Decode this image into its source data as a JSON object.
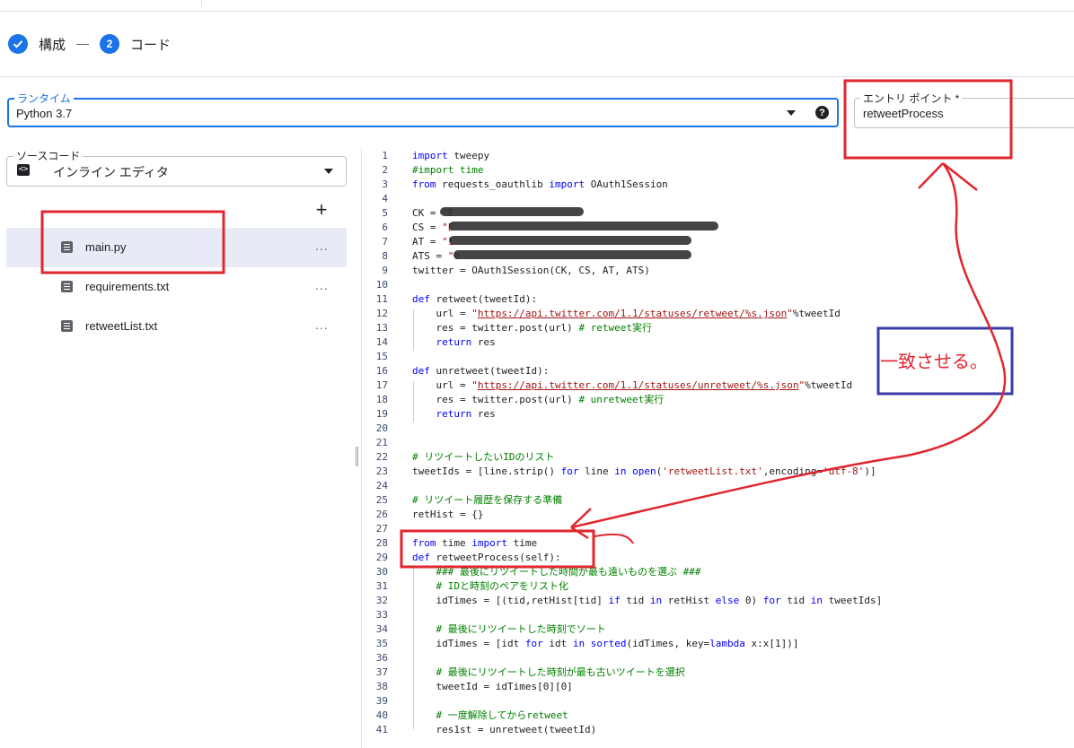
{
  "stepper": {
    "step1_label": "構成",
    "step2_number": "2",
    "step2_label": "コード"
  },
  "runtime": {
    "label": "ランタイム",
    "value": "Python 3.7",
    "help": "?"
  },
  "entry_point": {
    "label": "エントリ ポイント *",
    "value": "retweetProcess"
  },
  "source": {
    "label": "ソースコード",
    "value": "インライン エディタ"
  },
  "files": {
    "add": "+",
    "items": [
      {
        "name": "main.py",
        "more": "..."
      },
      {
        "name": "requirements.txt",
        "more": "..."
      },
      {
        "name": "retweetList.txt",
        "more": "..."
      }
    ]
  },
  "annotation": {
    "text": "一致させる。"
  },
  "code": {
    "lines": [
      {
        "n": "1",
        "t": "import tweepy"
      },
      {
        "n": "2",
        "t": "#import time"
      },
      {
        "n": "3",
        "t": "from requests_oauthlib import OAuth1Session"
      },
      {
        "n": "4",
        "t": ""
      },
      {
        "n": "5",
        "t": "CK = \"E"
      },
      {
        "n": "6",
        "t": "CS = \"E"
      },
      {
        "n": "7",
        "t": "AT = \"1"
      },
      {
        "n": "8",
        "t": "ATS = \"e"
      },
      {
        "n": "9",
        "t": "twitter = OAuth1Session(CK, CS, AT, ATS)"
      },
      {
        "n": "10",
        "t": ""
      },
      {
        "n": "11",
        "t": "def retweet(tweetId):"
      },
      {
        "n": "12",
        "t": "    url = \"https://api.twitter.com/1.1/statuses/retweet/%s.json\"%tweetId"
      },
      {
        "n": "13",
        "t": "    res = twitter.post(url) # retweet実行"
      },
      {
        "n": "14",
        "t": "    return res"
      },
      {
        "n": "15",
        "t": ""
      },
      {
        "n": "16",
        "t": "def unretweet(tweetId):"
      },
      {
        "n": "17",
        "t": "    url = \"https://api.twitter.com/1.1/statuses/unretweet/%s.json\"%tweetId"
      },
      {
        "n": "18",
        "t": "    res = twitter.post(url) # unretweet実行"
      },
      {
        "n": "19",
        "t": "    return res"
      },
      {
        "n": "20",
        "t": ""
      },
      {
        "n": "21",
        "t": ""
      },
      {
        "n": "22",
        "t": "# リツイートしたいIDのリスト"
      },
      {
        "n": "23",
        "t": "tweetIds = [line.strip() for line in open('retweetList.txt',encoding='utf-8')]"
      },
      {
        "n": "24",
        "t": ""
      },
      {
        "n": "25",
        "t": "# リツイート履歴を保存する準備"
      },
      {
        "n": "26",
        "t": "retHist = {}"
      },
      {
        "n": "27",
        "t": ""
      },
      {
        "n": "28",
        "t": "from time import time"
      },
      {
        "n": "29",
        "t": "def retweetProcess(self):"
      },
      {
        "n": "30",
        "t": "    ### 最後にリツイートした時間が最も遠いものを選ぶ ###"
      },
      {
        "n": "31",
        "t": "    # IDと時刻のペアをリスト化"
      },
      {
        "n": "32",
        "t": "    idTimes = [(tid,retHist[tid] if tid in retHist else 0) for tid in tweetIds]"
      },
      {
        "n": "33",
        "t": ""
      },
      {
        "n": "34",
        "t": "    # 最後にリツイートした時刻でソート"
      },
      {
        "n": "35",
        "t": "    idTimes = [idt for idt in sorted(idTimes, key=lambda x:x[1])]"
      },
      {
        "n": "36",
        "t": ""
      },
      {
        "n": "37",
        "t": "    # 最後にリツイートした時刻が最も古いツイートを選択"
      },
      {
        "n": "38",
        "t": "    tweetId = idTimes[0][0]"
      },
      {
        "n": "39",
        "t": ""
      },
      {
        "n": "40",
        "t": "    # 一度解除してからretweet"
      },
      {
        "n": "41",
        "t": "    res1st = unretweet(tweetId)"
      }
    ]
  }
}
